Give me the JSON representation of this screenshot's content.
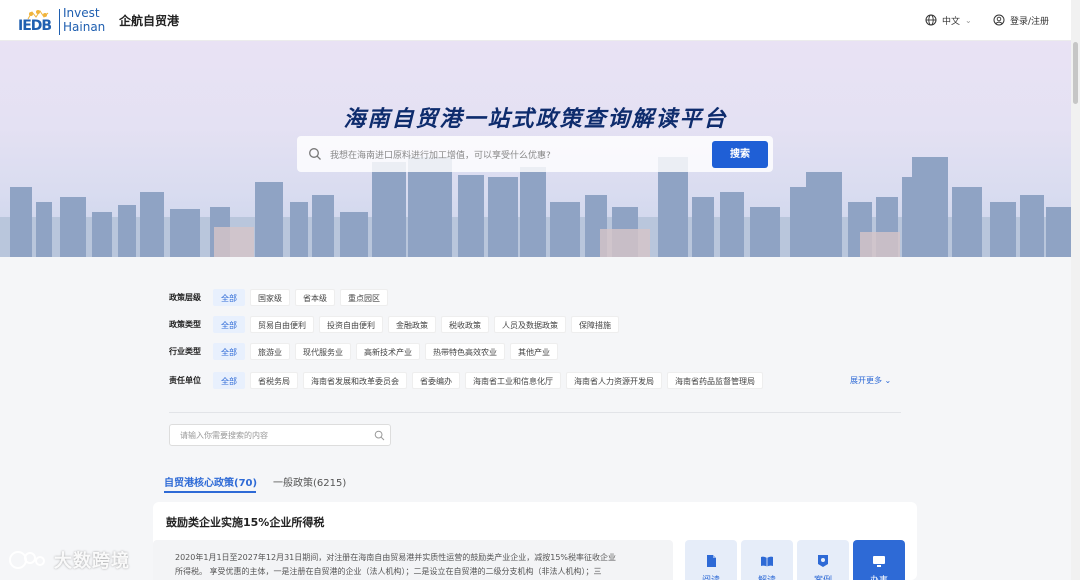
{
  "header": {
    "logo_mark": "IEDB",
    "logo_line1": "Invest",
    "logo_line2": "Hainan",
    "brand_name": "企航自贸港",
    "language": "中文",
    "login": "登录/注册",
    "icons": {
      "language": "globe-icon",
      "login": "user-circle-icon",
      "dropdown": "chevron-down-icon"
    }
  },
  "banner": {
    "title": "海南自贸港一站式政策查询解读平台",
    "search_placeholder": "我想在海南进口原料进行加工增值，可以享受什么优惠?",
    "search_button": "搜索"
  },
  "filters": {
    "rows": [
      {
        "label": "政策层级",
        "options": [
          "全部",
          "国家级",
          "省本级",
          "重点园区"
        ],
        "selected": "全部"
      },
      {
        "label": "政策类型",
        "options": [
          "全部",
          "贸易自由便利",
          "投资自由便利",
          "金融政策",
          "税收政策",
          "人员及数据政策",
          "保障措施"
        ],
        "selected": "全部"
      },
      {
        "label": "行业类型",
        "options": [
          "全部",
          "旅游业",
          "现代服务业",
          "高新技术产业",
          "热带特色高效农业",
          "其他产业"
        ],
        "selected": "全部"
      },
      {
        "label": "责任单位",
        "options": [
          "全部",
          "省税务局",
          "海南省发展和改革委员会",
          "省委编办",
          "海南省工业和信息化厅",
          "海南省人力资源开发局",
          "海南省药品监督管理局"
        ],
        "selected": "全部"
      }
    ],
    "expand_more": "展开更多"
  },
  "list_search": {
    "placeholder": "请输入你需要搜索的内容"
  },
  "tabs": [
    {
      "label": "自贸港核心政策(70)",
      "active": true
    },
    {
      "label": "一般政策(6215)",
      "active": false
    }
  ],
  "policy_card": {
    "title": "鼓励类企业实施15%企业所得税",
    "summary_line1": "2020年1月1日至2027年12月31日期间，对注册在海南自由贸易港并实质性运营的鼓励类产业企业，减按15%税率征收企业",
    "summary_line2": "所得税。 享受优惠的主体，一是注册在自贸港的企业（法人机构）；二是设立在自贸港的二级分支机构（非法人机构）；三",
    "actions": [
      {
        "label": "阅读",
        "icon": "document-icon"
      },
      {
        "label": "解读",
        "icon": "book-open-icon"
      },
      {
        "label": "案例",
        "icon": "badge-icon"
      },
      {
        "label": "办事",
        "icon": "monitor-icon"
      }
    ]
  },
  "watermark": {
    "text": "大数跨境"
  },
  "colors": {
    "primary": "#2e6ad6",
    "search_button": "#1f5fd6",
    "title": "#0e2c6d",
    "logo": "#1f5fb0"
  }
}
